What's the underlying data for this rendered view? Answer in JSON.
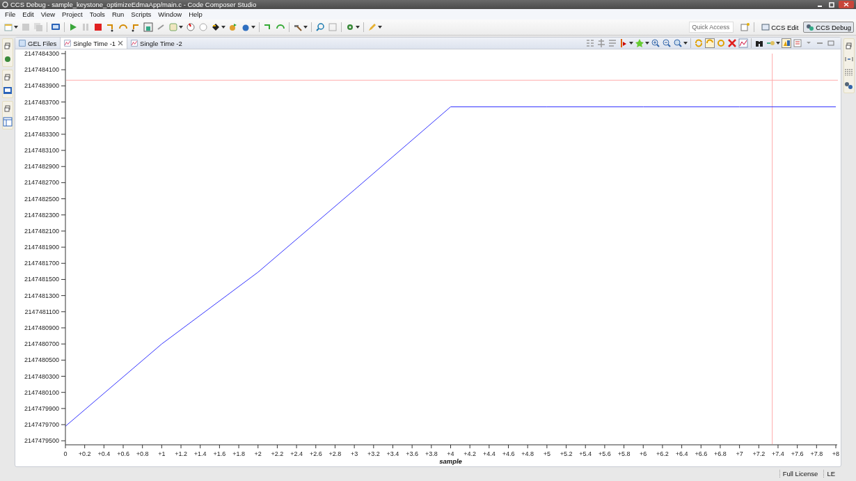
{
  "window": {
    "title": "CCS Debug - sample_keystone_optimizeEdmaApp/main.c - Code Composer Studio"
  },
  "menu": [
    "File",
    "Edit",
    "View",
    "Project",
    "Tools",
    "Run",
    "Scripts",
    "Window",
    "Help"
  ],
  "quick_access": {
    "placeholder": "Quick Access"
  },
  "perspectives": [
    {
      "label": "CCS Edit",
      "selected": false
    },
    {
      "label": "CCS Debug",
      "selected": true
    }
  ],
  "tabs": [
    {
      "label": "GEL Files",
      "selected": false,
      "closable": false
    },
    {
      "label": "Single Time -1",
      "selected": true,
      "closable": true
    },
    {
      "label": "Single Time -2",
      "selected": false,
      "closable": false
    }
  ],
  "chart": {
    "chart_data": {
      "type": "line",
      "xlabel": "sample",
      "x": [
        0,
        1,
        2,
        3,
        4,
        5,
        6,
        7,
        8
      ],
      "series": [
        {
          "color": "#3333ff",
          "values": [
            2147479680,
            2147480700,
            2147481590,
            2147482610,
            2147483640,
            2147483640,
            2147483640,
            2147483640,
            2147483640
          ]
        }
      ],
      "xlim": [
        0,
        8
      ],
      "ylim": [
        2147479450,
        2147484300
      ],
      "xticks": [
        0,
        {
          "value": 0.2,
          "label": "+0.2"
        },
        {
          "value": 0.4,
          "label": "+0.4"
        },
        {
          "value": 0.6,
          "label": "+0.6"
        },
        {
          "value": 0.8,
          "label": "+0.8"
        },
        {
          "value": 1,
          "label": "+1"
        },
        {
          "value": 1.2,
          "label": "+1.2"
        },
        {
          "value": 1.4,
          "label": "+1.4"
        },
        {
          "value": 1.6,
          "label": "+1.6"
        },
        {
          "value": 1.8,
          "label": "+1.8"
        },
        {
          "value": 2,
          "label": "+2"
        },
        {
          "value": 2.2,
          "label": "+2.2"
        },
        {
          "value": 2.4,
          "label": "+2.4"
        },
        {
          "value": 2.6,
          "label": "+2.6"
        },
        {
          "value": 2.8,
          "label": "+2.8"
        },
        {
          "value": 3,
          "label": "+3"
        },
        {
          "value": 3.2,
          "label": "+3.2"
        },
        {
          "value": 3.4,
          "label": "+3.4"
        },
        {
          "value": 3.6,
          "label": "+3.6"
        },
        {
          "value": 3.8,
          "label": "+3.8"
        },
        {
          "value": 4,
          "label": "+4"
        },
        {
          "value": 4.2,
          "label": "+4.2"
        },
        {
          "value": 4.4,
          "label": "+4.4"
        },
        {
          "value": 4.6,
          "label": "+4.6"
        },
        {
          "value": 4.8,
          "label": "+4.8"
        },
        {
          "value": 5,
          "label": "+5"
        },
        {
          "value": 5.2,
          "label": "+5.2"
        },
        {
          "value": 5.4,
          "label": "+5.4"
        },
        {
          "value": 5.6,
          "label": "+5.6"
        },
        {
          "value": 5.8,
          "label": "+5.8"
        },
        {
          "value": 6,
          "label": "+6"
        },
        {
          "value": 6.2,
          "label": "+6.2"
        },
        {
          "value": 6.4,
          "label": "+6.4"
        },
        {
          "value": 6.6,
          "label": "+6.6"
        },
        {
          "value": 6.8,
          "label": "+6.8"
        },
        {
          "value": 7,
          "label": "+7"
        },
        {
          "value": 7.2,
          "label": "+7.2"
        },
        {
          "value": 7.4,
          "label": "+7.4"
        },
        {
          "value": 7.6,
          "label": "+7.6"
        },
        {
          "value": 7.8,
          "label": "+7.8"
        },
        {
          "value": 8,
          "label": "+8"
        }
      ],
      "yticks": [
        2147479500,
        2147479700,
        2147479900,
        2147480100,
        2147480300,
        2147480500,
        2147480700,
        2147480900,
        2147481100,
        2147481300,
        2147481500,
        2147481700,
        2147481900,
        2147482100,
        2147482300,
        2147482500,
        2147482700,
        2147482900,
        2147483100,
        2147483300,
        2147483500,
        2147483700,
        2147483900,
        2147484100,
        2147484300
      ],
      "ref_lines": [
        {
          "axis": "y",
          "value": 2147483970
        },
        {
          "axis": "x",
          "value": 7.34
        }
      ]
    }
  },
  "status_bar": [
    "Full License",
    "LE"
  ]
}
